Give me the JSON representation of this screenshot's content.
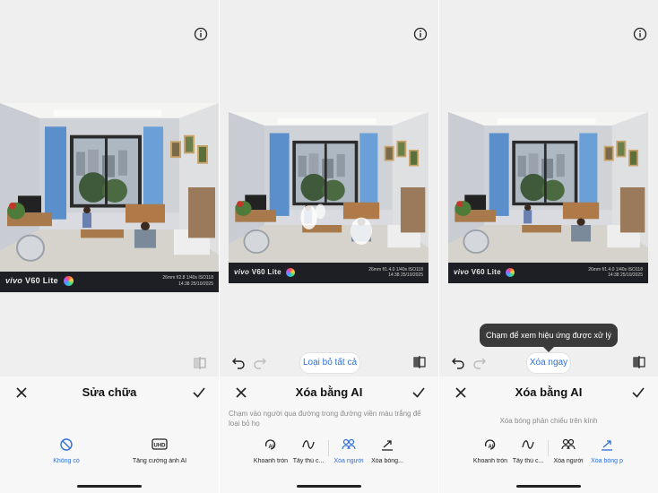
{
  "panels": [
    {
      "id": "repair",
      "brand": "vivo",
      "model": "V60 Lite",
      "exif_line1": "26mm f/2.8 1/40s ISO118",
      "exif_line2": "14:38 25/10/2025",
      "sheet_title": "Sửa chữa",
      "options": [
        {
          "icon": "no-entry-icon",
          "label": "Không có",
          "active": true
        },
        {
          "icon": "uhd-icon",
          "label": "Tăng cường ảnh AI",
          "active": false
        }
      ]
    },
    {
      "id": "ai-erase-people",
      "brand": "vivo",
      "model": "V60 Lite",
      "exif_line1": "26mm f/1.4.0 1/40s ISO118",
      "exif_line2": "14:38 25/10/2025",
      "action_button": "Loại bỏ tất cả",
      "sheet_title": "Xóa bằng AI",
      "hint": "Chạm vào người qua đường trong đường viền màu trắng để loại bỏ họ",
      "options": [
        {
          "icon": "ai-circle-icon",
          "label": "Khoanh tròn",
          "active": false
        },
        {
          "icon": "squiggle-icon",
          "label": "Tẩy thủ c...",
          "active": false
        },
        {
          "icon": "people-icon",
          "label": "Xóa người",
          "active": true
        },
        {
          "icon": "reflection-icon",
          "label": "Xóa bóng...",
          "active": false
        }
      ]
    },
    {
      "id": "ai-erase-reflection",
      "brand": "vivo",
      "model": "V60 Lite",
      "exif_line1": "26mm f/1.4.0 1/40s ISO118",
      "exif_line2": "14:38 25/10/2025",
      "action_button": "Xóa ngay",
      "tooltip": "Chạm để xem hiệu ứng được xử lý",
      "sheet_title": "Xóa bằng AI",
      "hint": "Xóa bóng phản chiếu trên kính",
      "options": [
        {
          "icon": "ai-circle-icon",
          "label": "Khoanh tròn",
          "active": false
        },
        {
          "icon": "squiggle-icon",
          "label": "Tẩy thủ c...",
          "active": false
        },
        {
          "icon": "people-icon",
          "label": "Xóa người",
          "active": false
        },
        {
          "icon": "reflection-icon",
          "label": "Xóa bóng p",
          "active": true
        }
      ]
    }
  ],
  "colors": {
    "accent": "#2f6fd6",
    "panel_bg": "#efefef",
    "sheet_bg": "#f7f7f7",
    "caption_bg": "#1e1f24"
  }
}
